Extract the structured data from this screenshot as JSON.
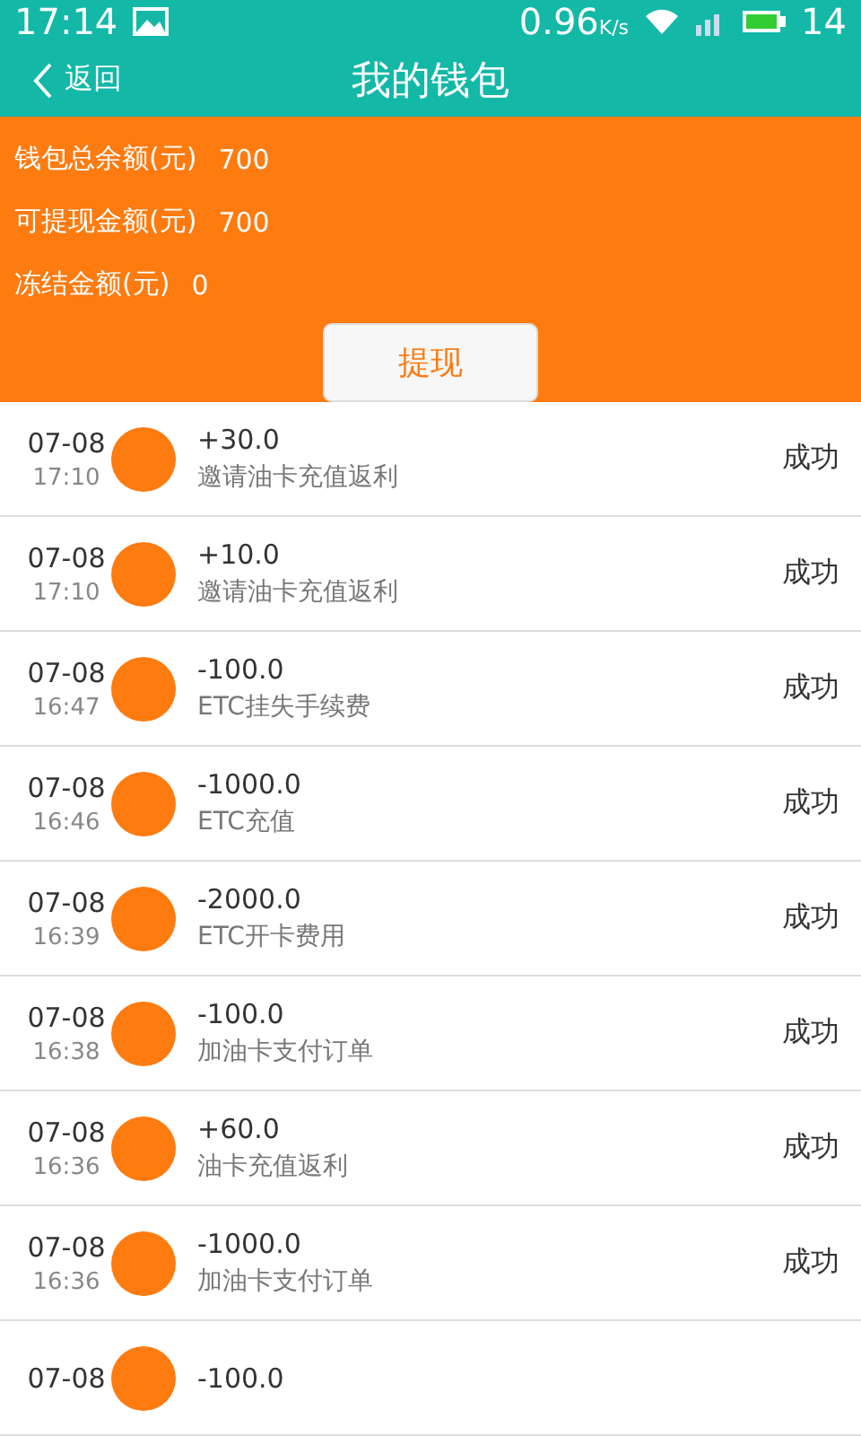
{
  "status_bar": {
    "time": "17:14",
    "speed": "0.96",
    "speed_unit": "K/s",
    "battery": "14"
  },
  "header": {
    "back": "返回",
    "title": "我的钱包"
  },
  "summary": [
    {
      "label": "钱包总余额(元)",
      "value": "700"
    },
    {
      "label": "可提现金额(元)",
      "value": "700"
    },
    {
      "label": "冻结金额(元)",
      "value": "0"
    }
  ],
  "withdraw_button": "提现",
  "records": [
    {
      "date": "07-08",
      "time": "17:10",
      "amount": "+30.0",
      "desc": "邀请油卡充值返利",
      "status": "成功"
    },
    {
      "date": "07-08",
      "time": "17:10",
      "amount": "+10.0",
      "desc": "邀请油卡充值返利",
      "status": "成功"
    },
    {
      "date": "07-08",
      "time": "16:47",
      "amount": "-100.0",
      "desc": "ETC挂失手续费",
      "status": "成功"
    },
    {
      "date": "07-08",
      "time": "16:46",
      "amount": "-1000.0",
      "desc": "ETC充值",
      "status": "成功"
    },
    {
      "date": "07-08",
      "time": "16:39",
      "amount": "-2000.0",
      "desc": "ETC开卡费用",
      "status": "成功"
    },
    {
      "date": "07-08",
      "time": "16:38",
      "amount": "-100.0",
      "desc": "加油卡支付订单",
      "status": "成功"
    },
    {
      "date": "07-08",
      "time": "16:36",
      "amount": "+60.0",
      "desc": "油卡充值返利",
      "status": "成功"
    },
    {
      "date": "07-08",
      "time": "16:36",
      "amount": "-1000.0",
      "desc": "加油卡支付订单",
      "status": "成功"
    },
    {
      "date": "07-08",
      "amount": "-100.0"
    }
  ]
}
